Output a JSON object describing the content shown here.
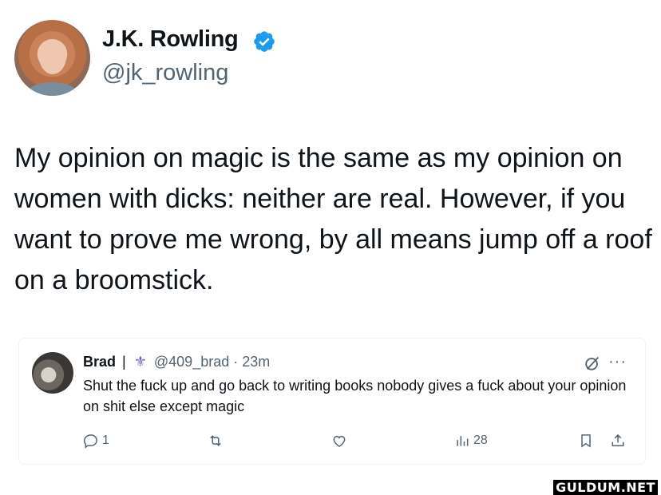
{
  "tweet": {
    "author_name": "J.K. Rowling",
    "author_handle": "@jk_rowling",
    "text": "My opinion on magic is the same as my opinion on women with dicks: neither are real. However, if you want to prove me wrong, by all means jump off a roof on a broomstick."
  },
  "reply": {
    "author_name": "Brad",
    "separator": "|",
    "emoji": "⚜",
    "handle": "@409_brad",
    "time": "· 23m",
    "text": "Shut the fuck up and go back to writing books nobody gives a fuck about your opinion on shit else except magic",
    "more": "···",
    "reply_count": "1",
    "retweet_count": "",
    "like_count": "",
    "view_count": "28"
  },
  "colors": {
    "verified_blue": "#1d9bf0",
    "text": "#0f1419",
    "secondary": "#536471"
  },
  "icons": [
    "verified-badge-icon",
    "grok-icon",
    "more-icon",
    "reply-icon",
    "retweet-icon",
    "like-icon",
    "views-icon",
    "bookmark-icon",
    "share-icon"
  ],
  "watermark": "GULDUM.NET"
}
